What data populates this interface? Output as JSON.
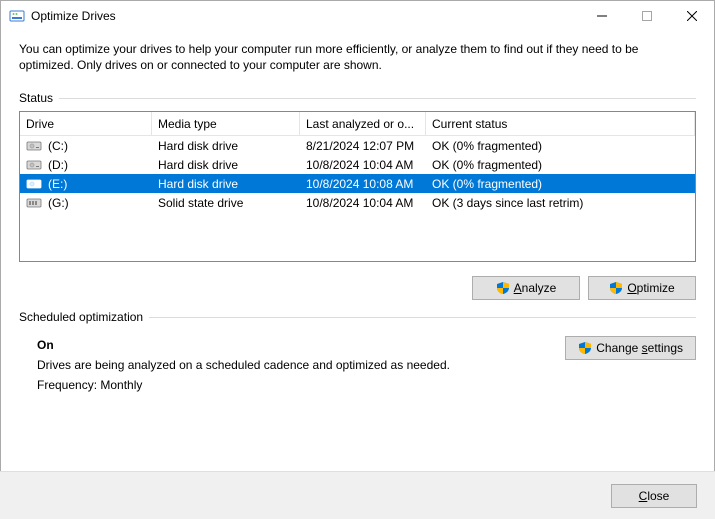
{
  "titlebar": {
    "title": "Optimize Drives"
  },
  "intro": "You can optimize your drives to help your computer run more efficiently, or analyze them to find out if they need to be optimized. Only drives on or connected to your computer are shown.",
  "status_label": "Status",
  "columns": {
    "drive": "Drive",
    "media": "Media type",
    "last": "Last analyzed or o...",
    "status": "Current status"
  },
  "rows": [
    {
      "drive": "(C:)",
      "media": "Hard disk drive",
      "last": "8/21/2024 12:07 PM",
      "status": "OK (0% fragmented)",
      "icon": "hdd",
      "selected": false
    },
    {
      "drive": "(D:)",
      "media": "Hard disk drive",
      "last": "10/8/2024 10:04 AM",
      "status": "OK (0% fragmented)",
      "icon": "hdd",
      "selected": false
    },
    {
      "drive": "(E:)",
      "media": "Hard disk drive",
      "last": "10/8/2024 10:08 AM",
      "status": "OK (0% fragmented)",
      "icon": "hdd",
      "selected": true
    },
    {
      "drive": "(G:)",
      "media": "Solid state drive",
      "last": "10/8/2024 10:04 AM",
      "status": "OK (3 days since last retrim)",
      "icon": "ssd",
      "selected": false
    }
  ],
  "buttons": {
    "analyze_pre": "A",
    "analyze_post": "nalyze",
    "optimize_pre": "O",
    "optimize_post": "ptimize",
    "change_pre": "Change ",
    "change_u": "s",
    "change_post": "ettings",
    "close_pre": "",
    "close_u": "C",
    "close_post": "lose"
  },
  "sched": {
    "label": "Scheduled optimization",
    "on": "On",
    "desc": "Drives are being analyzed on a scheduled cadence and optimized as needed.",
    "freq": "Frequency: Monthly"
  }
}
